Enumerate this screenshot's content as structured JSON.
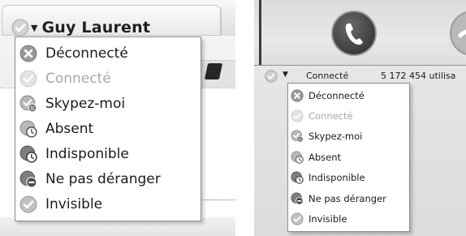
{
  "left": {
    "user_name": "Guy Laurent",
    "current_status_icon": "status-connected-icon",
    "caret_icon": "dropdown-caret-icon",
    "menu": [
      {
        "label": "Déconnecté",
        "icon": "status-offline-icon",
        "disabled": false
      },
      {
        "label": "Connecté",
        "icon": "status-online-icon",
        "disabled": true
      },
      {
        "label": "Skypez-moi",
        "icon": "status-skype-me-icon",
        "disabled": false
      },
      {
        "label": "Absent",
        "icon": "status-away-icon",
        "disabled": false
      },
      {
        "label": "Indisponible",
        "icon": "status-not-available-icon",
        "disabled": false
      },
      {
        "label": "Ne pas déranger",
        "icon": "status-do-not-disturb-icon",
        "disabled": false
      },
      {
        "label": "Invisible",
        "icon": "status-invisible-icon",
        "disabled": false
      }
    ]
  },
  "right": {
    "status_label": "Connecté",
    "online_users": "5 172 454 utilisa",
    "current_status_icon": "status-connected-icon",
    "call_button_icon": "phone-handset-icon",
    "menu": [
      {
        "label": "Déconnecté",
        "icon": "status-offline-icon",
        "disabled": false
      },
      {
        "label": "Connecté",
        "icon": "status-online-icon",
        "disabled": true
      },
      {
        "label": "Skypez-moi",
        "icon": "status-skype-me-icon",
        "disabled": false
      },
      {
        "label": "Absent",
        "icon": "status-away-icon",
        "disabled": false
      },
      {
        "label": "Indisponible",
        "icon": "status-not-available-icon",
        "disabled": false
      },
      {
        "label": "Ne pas déranger",
        "icon": "status-do-not-disturb-icon",
        "disabled": false
      },
      {
        "label": "Invisible",
        "icon": "status-invisible-icon",
        "disabled": false
      }
    ]
  },
  "colors": {
    "icon_dark": "#5a5a5a",
    "icon_light": "#cfcfcf",
    "text_disabled": "#a8a8a8",
    "call_button": "#4a4a4a"
  }
}
